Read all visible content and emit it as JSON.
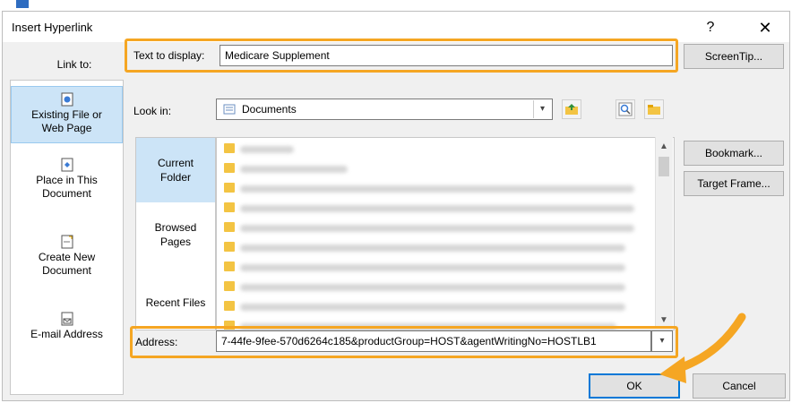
{
  "window": {
    "title": "Insert Hyperlink",
    "help_glyph": "?",
    "close_glyph": "✕"
  },
  "left_panel": {
    "label": "Link to:",
    "items": [
      {
        "line1": "Existing File or",
        "line2": "Web Page"
      },
      {
        "line1": "Place in This",
        "line2": "Document"
      },
      {
        "line1": "Create New",
        "line2": "Document"
      },
      {
        "line1": "E-mail Address",
        "line2": ""
      }
    ]
  },
  "text_to_display": {
    "label": "Text to display:",
    "value": "Medicare Supplement"
  },
  "look_in": {
    "label": "Look in:",
    "value": "Documents"
  },
  "places": [
    {
      "line1": "Current",
      "line2": "Folder"
    },
    {
      "line1": "Browsed",
      "line2": "Pages"
    },
    {
      "line1": "Recent Files",
      "line2": ""
    }
  ],
  "address": {
    "label": "Address:",
    "value": "7-44fe-9fee-570d6264c185&productGroup=HOST&agentWritingNo=HOSTLB1"
  },
  "buttons": {
    "screentip": "ScreenTip...",
    "bookmark": "Bookmark...",
    "target_frame": "Target Frame...",
    "ok": "OK",
    "cancel": "Cancel"
  },
  "colors": {
    "highlight": "#f5a623",
    "selection": "#cce4f7",
    "primary_border": "#0078d7"
  }
}
